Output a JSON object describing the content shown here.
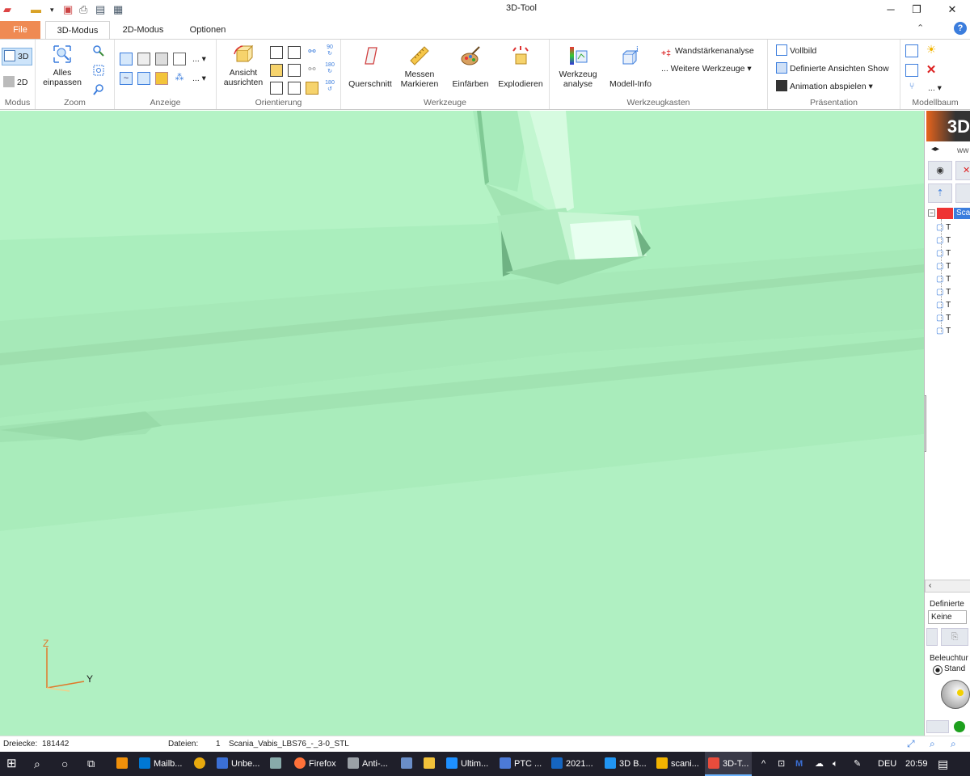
{
  "window": {
    "title": "3D-Tool"
  },
  "tabs": [
    {
      "label": "File"
    },
    {
      "label": "3D-Modus"
    },
    {
      "label": "2D-Modus"
    },
    {
      "label": "Optionen"
    }
  ],
  "ribbon": {
    "modus": {
      "label": "Modus",
      "b3d": "3D",
      "b2d": "2D"
    },
    "zoom": {
      "label": "Zoom",
      "fit_line1": "Alles",
      "fit_line2": "einpassen"
    },
    "anzeige": {
      "label": "Anzeige"
    },
    "orientierung": {
      "label": "Orientierung",
      "align_line1": "Ansicht",
      "align_line2": "ausrichten"
    },
    "werkzeuge": {
      "label": "Werkzeuge",
      "querschnitt": "Querschnitt",
      "messen1": "Messen",
      "messen2": "Markieren",
      "einfaerben": "Einfärben",
      "explodieren": "Explodieren"
    },
    "werkzeugkasten": {
      "label": "Werkzeugkasten",
      "wz1": "Werkzeug",
      "wz2": "analyse",
      "modellinfo": "Modell-Info",
      "wandstaerke": "Wandstärkenanalyse",
      "weitere": "Weitere Werkzeuge"
    },
    "praesentation": {
      "label": "Präsentation",
      "vollbild": "Vollbild",
      "definierte": "Definierte Ansichten Show",
      "animation": "Animation abspielen"
    },
    "modellbaum": {
      "label": "Modellbaum"
    }
  },
  "panel": {
    "logo": "3D",
    "www": "ww",
    "tree_root": "Sca",
    "tree_child": "T",
    "definierte_label": "Definierte",
    "definierte_value": "Keine",
    "beleuchtung_label": "Beleuchtur",
    "beleuchtung_option": "Stand"
  },
  "axes": {
    "z": "Z",
    "y": "Y"
  },
  "status": {
    "dreiecke_label": "Dreiecke:",
    "dreiecke_value": "181442",
    "dateien_label": "Dateien:",
    "dateien_count": "1",
    "file_name": "Scania_Vabis_LBS76_-_3-0_STL"
  },
  "taskbar": {
    "apps": [
      {
        "label": "Mailb...",
        "color": "#0078d4"
      },
      {
        "label": "Unbe...",
        "color": "#3b6fd4"
      },
      {
        "label": "Firefox",
        "color": "#ff7139"
      },
      {
        "label": "Anti-...",
        "color": "#9aa0a6"
      },
      {
        "label": "Ultim...",
        "color": "#1e90ff"
      },
      {
        "label": "PTC ...",
        "color": "#4c7ad6"
      },
      {
        "label": "2021...",
        "color": "#1565c0"
      },
      {
        "label": "3D B...",
        "color": "#2196f3"
      },
      {
        "label": "scani...",
        "color": "#f2b400"
      },
      {
        "label": "3D-T...",
        "color": "#e74c3c"
      }
    ],
    "lang": "DEU",
    "time": "20:59"
  }
}
